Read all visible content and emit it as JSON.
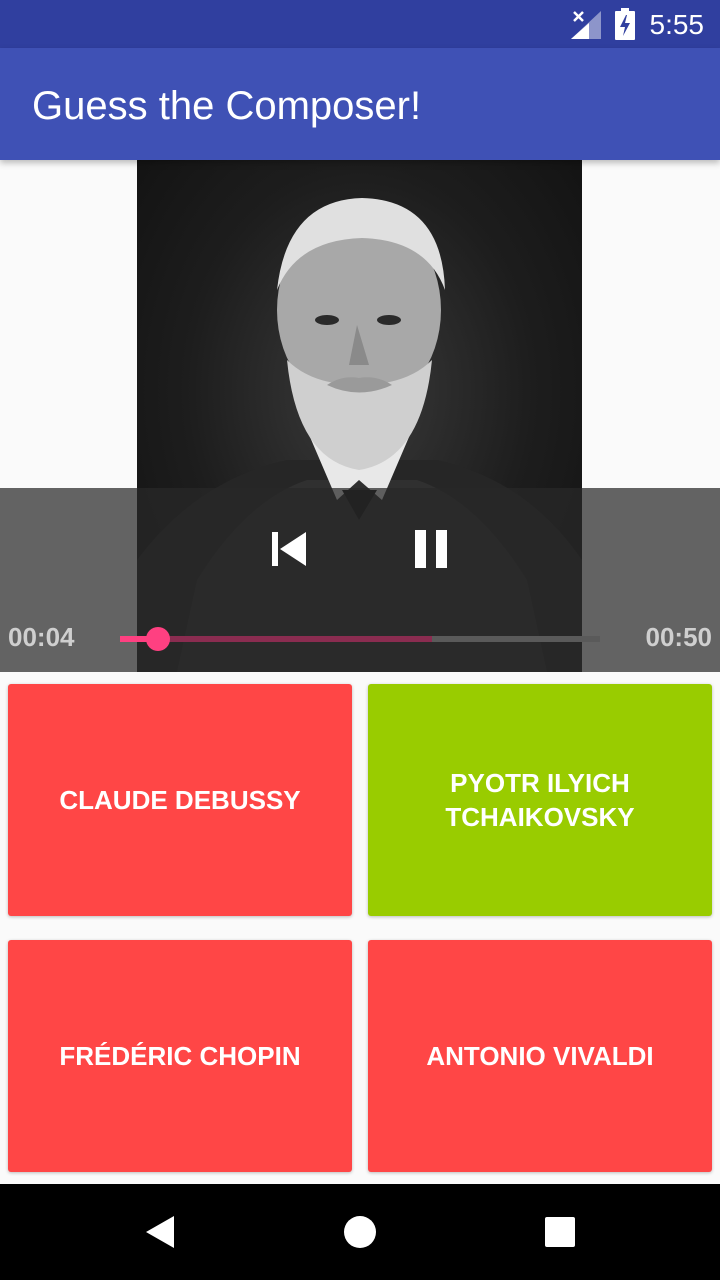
{
  "status_bar": {
    "time": "5:55"
  },
  "app_bar": {
    "title": "Guess the Composer!"
  },
  "player": {
    "elapsed": "00:04",
    "duration": "00:50",
    "progress_fraction": 0.08,
    "buffered_fraction": 0.65
  },
  "choices": [
    {
      "label": "CLAUDE DEBUSSY",
      "color": "#ff4646"
    },
    {
      "label": "PYOTR ILYICH TCHAIKOVSKY",
      "color": "#99cc00"
    },
    {
      "label": "FRÉDÉRIC CHOPIN",
      "color": "#ff4646"
    },
    {
      "label": "ANTONIO VIVALDI",
      "color": "#ff4646"
    }
  ]
}
